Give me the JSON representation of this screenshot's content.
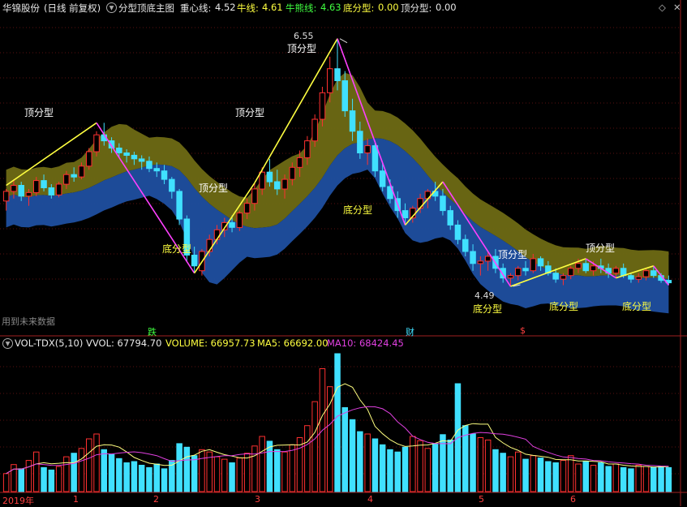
{
  "header": {
    "stock": "华锦股份",
    "period": "(日线 前复权)",
    "indicator": "分型顶底主图",
    "center_label": "重心线:",
    "center_value": "4.52",
    "bull_label": "牛线:",
    "bull_value": "4.61",
    "bear_label": "牛熊线:",
    "bear_value": "4.63",
    "bottom_label": "底分型:",
    "bottom_value": "0.00",
    "top_label": "顶分型:",
    "top_value": "0.00"
  },
  "volume_header": {
    "name": "VOL-TDX(5,10)",
    "vvol": "VVOL: 67794.70",
    "volume": "VOLUME: 66957.73",
    "ma5": "MA5: 66692.00",
    "ma10": "MA10: 68424.45"
  },
  "annotations": {
    "top_label": "顶分型",
    "bottom_label": "底分型",
    "high_price": "6.55",
    "low_price": "4.49"
  },
  "future_hint": "用到未来数据",
  "events": [
    "跌",
    "财",
    "$"
  ],
  "x_axis": {
    "year": "2019年",
    "months": [
      "1",
      "2",
      "3",
      "4",
      "5",
      "6"
    ]
  },
  "colors": {
    "background": "#000000",
    "up_candle": "#ff3030",
    "down_candle": "#40e0ff",
    "band_olive": "#6e6a14",
    "band_blue": "#1f4fa0",
    "top_line": "#ffff40",
    "bottom_line": "#ff40ff",
    "ma5": "#ffff80",
    "ma10": "#e040e0"
  },
  "chart_data": {
    "type": "candlestick",
    "title": "分型顶底主图",
    "ylim": [
      4.2,
      6.75
    ],
    "ohlc": [
      [
        5.2,
        5.3,
        5.12,
        5.28
      ],
      [
        5.28,
        5.38,
        5.22,
        5.33
      ],
      [
        5.33,
        5.36,
        5.2,
        5.24
      ],
      [
        5.24,
        5.3,
        5.16,
        5.27
      ],
      [
        5.27,
        5.4,
        5.24,
        5.37
      ],
      [
        5.37,
        5.42,
        5.28,
        5.31
      ],
      [
        5.31,
        5.34,
        5.22,
        5.25
      ],
      [
        5.25,
        5.36,
        5.23,
        5.34
      ],
      [
        5.34,
        5.45,
        5.3,
        5.42
      ],
      [
        5.42,
        5.48,
        5.36,
        5.4
      ],
      [
        5.4,
        5.52,
        5.38,
        5.49
      ],
      [
        5.49,
        5.64,
        5.46,
        5.61
      ],
      [
        5.61,
        5.78,
        5.57,
        5.75
      ],
      [
        5.75,
        5.85,
        5.66,
        5.7
      ],
      [
        5.7,
        5.73,
        5.6,
        5.64
      ],
      [
        5.64,
        5.68,
        5.56,
        5.6
      ],
      [
        5.6,
        5.63,
        5.52,
        5.58
      ],
      [
        5.58,
        5.61,
        5.5,
        5.55
      ],
      [
        5.55,
        5.58,
        5.46,
        5.53
      ],
      [
        5.53,
        5.57,
        5.44,
        5.47
      ],
      [
        5.47,
        5.52,
        5.4,
        5.45
      ],
      [
        5.45,
        5.5,
        5.34,
        5.38
      ],
      [
        5.38,
        5.4,
        5.22,
        5.28
      ],
      [
        5.28,
        5.3,
        5.0,
        5.05
      ],
      [
        5.05,
        5.08,
        4.7,
        4.75
      ],
      [
        4.75,
        4.82,
        4.6,
        4.66
      ],
      [
        4.62,
        4.8,
        4.58,
        4.78
      ],
      [
        4.78,
        4.92,
        4.74,
        4.88
      ],
      [
        4.88,
        5.0,
        4.84,
        4.96
      ],
      [
        4.96,
        5.06,
        4.9,
        5.02
      ],
      [
        5.02,
        5.08,
        4.94,
        4.98
      ],
      [
        4.98,
        5.12,
        4.95,
        5.1
      ],
      [
        5.1,
        5.22,
        5.05,
        5.18
      ],
      [
        5.18,
        5.35,
        5.12,
        5.3
      ],
      [
        5.3,
        5.48,
        5.25,
        5.44
      ],
      [
        5.44,
        5.55,
        5.32,
        5.36
      ],
      [
        5.36,
        5.46,
        5.25,
        5.3
      ],
      [
        5.3,
        5.42,
        5.22,
        5.38
      ],
      [
        5.38,
        5.52,
        5.33,
        5.48
      ],
      [
        5.48,
        5.62,
        5.4,
        5.56
      ],
      [
        5.56,
        5.74,
        5.5,
        5.7
      ],
      [
        5.7,
        5.92,
        5.65,
        5.88
      ],
      [
        5.88,
        6.15,
        5.82,
        6.1
      ],
      [
        6.1,
        6.4,
        6.02,
        6.3
      ],
      [
        6.3,
        6.55,
        6.12,
        6.2
      ],
      [
        6.2,
        6.28,
        5.9,
        5.95
      ],
      [
        5.95,
        6.05,
        5.7,
        5.78
      ],
      [
        5.78,
        5.86,
        5.55,
        5.6
      ],
      [
        5.6,
        5.72,
        5.5,
        5.66
      ],
      [
        5.66,
        5.7,
        5.4,
        5.45
      ],
      [
        5.45,
        5.52,
        5.28,
        5.32
      ],
      [
        5.32,
        5.38,
        5.18,
        5.22
      ],
      [
        5.22,
        5.28,
        5.06,
        5.12
      ],
      [
        5.12,
        5.18,
        5.0,
        5.06
      ],
      [
        5.06,
        5.16,
        5.02,
        5.14
      ],
      [
        5.14,
        5.26,
        5.1,
        5.22
      ],
      [
        5.22,
        5.3,
        5.14,
        5.28
      ],
      [
        5.28,
        5.36,
        5.2,
        5.24
      ],
      [
        5.24,
        5.3,
        5.08,
        5.12
      ],
      [
        5.12,
        5.16,
        4.96,
        5.0
      ],
      [
        5.0,
        5.04,
        4.84,
        4.88
      ],
      [
        4.88,
        4.92,
        4.74,
        4.78
      ],
      [
        4.78,
        4.84,
        4.62,
        4.68
      ],
      [
        4.68,
        4.74,
        4.58,
        4.7
      ],
      [
        4.7,
        4.78,
        4.62,
        4.74
      ],
      [
        4.74,
        4.8,
        4.6,
        4.64
      ],
      [
        4.64,
        4.68,
        4.52,
        4.56
      ],
      [
        4.56,
        4.6,
        4.49,
        4.58
      ],
      [
        4.58,
        4.66,
        4.54,
        4.64
      ],
      [
        4.64,
        4.7,
        4.58,
        4.62
      ],
      [
        4.62,
        4.76,
        4.6,
        4.72
      ],
      [
        4.72,
        4.74,
        4.62,
        4.66
      ],
      [
        4.66,
        4.7,
        4.58,
        4.6
      ],
      [
        4.6,
        4.64,
        4.52,
        4.55
      ],
      [
        4.55,
        4.6,
        4.5,
        4.58
      ],
      [
        4.58,
        4.66,
        4.55,
        4.64
      ],
      [
        4.64,
        4.72,
        4.6,
        4.68
      ],
      [
        4.68,
        4.72,
        4.6,
        4.62
      ],
      [
        4.62,
        4.7,
        4.58,
        4.66
      ],
      [
        4.66,
        4.72,
        4.6,
        4.64
      ],
      [
        4.64,
        4.68,
        4.56,
        4.6
      ],
      [
        4.6,
        4.66,
        4.56,
        4.64
      ],
      [
        4.64,
        4.68,
        4.56,
        4.58
      ],
      [
        4.58,
        4.6,
        4.52,
        4.55
      ],
      [
        4.55,
        4.6,
        4.52,
        4.57
      ],
      [
        4.57,
        4.64,
        4.54,
        4.62
      ],
      [
        4.62,
        4.66,
        4.56,
        4.58
      ],
      [
        4.58,
        4.6,
        4.52,
        4.54
      ],
      [
        4.54,
        4.58,
        4.5,
        4.52
      ]
    ],
    "volume": [
      30,
      45,
      38,
      52,
      66,
      40,
      36,
      42,
      58,
      64,
      72,
      88,
      96,
      70,
      62,
      55,
      48,
      50,
      44,
      40,
      46,
      38,
      52,
      80,
      74,
      60,
      70,
      66,
      58,
      54,
      48,
      56,
      64,
      76,
      92,
      84,
      70,
      66,
      78,
      90,
      110,
      150,
      205,
      175,
      230,
      140,
      120,
      100,
      96,
      88,
      78,
      70,
      66,
      74,
      92,
      85,
      72,
      80,
      95,
      86,
      180,
      110,
      96,
      90,
      86,
      70,
      64,
      58,
      66,
      54,
      60,
      56,
      50,
      48,
      52,
      60,
      46,
      50,
      44,
      48,
      42,
      46,
      40,
      38,
      44,
      42,
      40,
      42,
      40
    ]
  }
}
